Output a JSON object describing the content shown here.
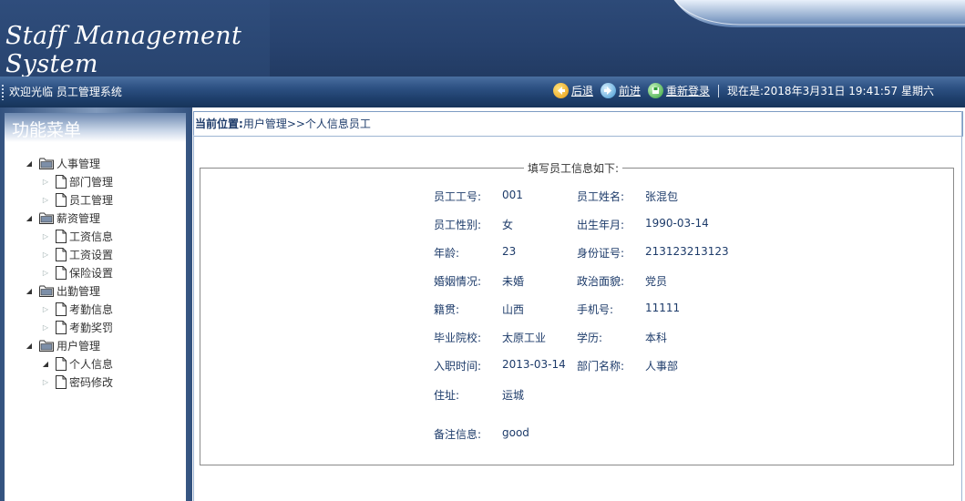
{
  "header": {
    "logo_text": "Staff Management System"
  },
  "navbar": {
    "welcome": "欢迎光临 员工管理系统",
    "back_label": "后退",
    "forward_label": "前进",
    "relogin_label": "重新登录",
    "datetime": "现在是:2018年3月31日 19:41:57 星期六"
  },
  "sidebar": {
    "title": "功能菜单",
    "groups": [
      {
        "label": "人事管理",
        "items": [
          {
            "label": "部门管理"
          },
          {
            "label": "员工管理"
          }
        ]
      },
      {
        "label": "薪资管理",
        "items": [
          {
            "label": "工资信息"
          },
          {
            "label": "工资设置"
          },
          {
            "label": "保险设置"
          }
        ]
      },
      {
        "label": "出勤管理",
        "items": [
          {
            "label": "考勤信息"
          },
          {
            "label": "考勤奖罚"
          }
        ]
      },
      {
        "label": "用户管理",
        "items": [
          {
            "label": "个人信息"
          },
          {
            "label": "密码修改"
          }
        ]
      }
    ]
  },
  "breadcrumb": {
    "prefix": "当前位置:",
    "path": "用户管理>>个人信息员工"
  },
  "form": {
    "legend": "填写员工信息如下:",
    "fields": {
      "emp_no": {
        "label": "员工工号:",
        "value": "001"
      },
      "name": {
        "label": "员工姓名:",
        "value": "张混包"
      },
      "gender": {
        "label": "员工性别:",
        "value": "女"
      },
      "birth": {
        "label": "出生年月:",
        "value": "1990-03-14"
      },
      "age": {
        "label": "年龄:",
        "value": "23"
      },
      "id_no": {
        "label": "身份证号:",
        "value": "213123213123"
      },
      "marital": {
        "label": "婚姻情况:",
        "value": "未婚"
      },
      "political": {
        "label": "政治面貌:",
        "value": "党员"
      },
      "native": {
        "label": "籍贯:",
        "value": "山西"
      },
      "phone": {
        "label": "手机号:",
        "value": "11111"
      },
      "school": {
        "label": "毕业院校:",
        "value": "太原工业"
      },
      "education": {
        "label": "学历:",
        "value": "本科"
      },
      "hire_date": {
        "label": "入职时间:",
        "value": "2013-03-14"
      },
      "department": {
        "label": "部门名称:",
        "value": "人事部"
      },
      "address": {
        "label": "住址:",
        "value": "运城"
      },
      "remark": {
        "label": "备注信息:",
        "value": "good"
      }
    }
  }
}
